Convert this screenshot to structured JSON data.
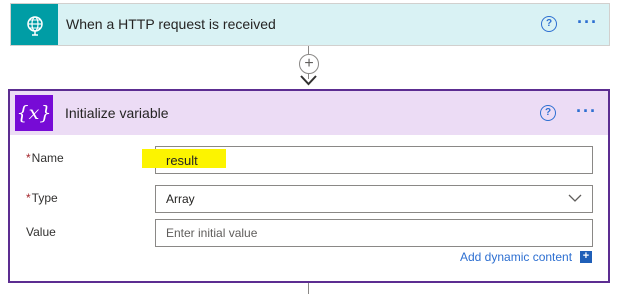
{
  "trigger": {
    "title": "When a HTTP request is received",
    "icon": "globe-request-icon",
    "help": "?",
    "more": "···",
    "accent": "#009da5",
    "bg": "#d9f2f4"
  },
  "connector": {
    "add_symbol": "+"
  },
  "action": {
    "title": "Initialize variable",
    "icon_text": "{x}",
    "help": "?",
    "more": "···",
    "accent": "#770bd6",
    "border": "#5c2d91",
    "fields": {
      "name": {
        "required": "*",
        "label": "Name",
        "value": "result"
      },
      "type": {
        "required": "*",
        "label": "Type",
        "value": "Array"
      },
      "value": {
        "label": "Value",
        "placeholder": "Enter initial value"
      }
    },
    "dynamic_content": {
      "label": "Add dynamic content",
      "icon": "+"
    }
  }
}
